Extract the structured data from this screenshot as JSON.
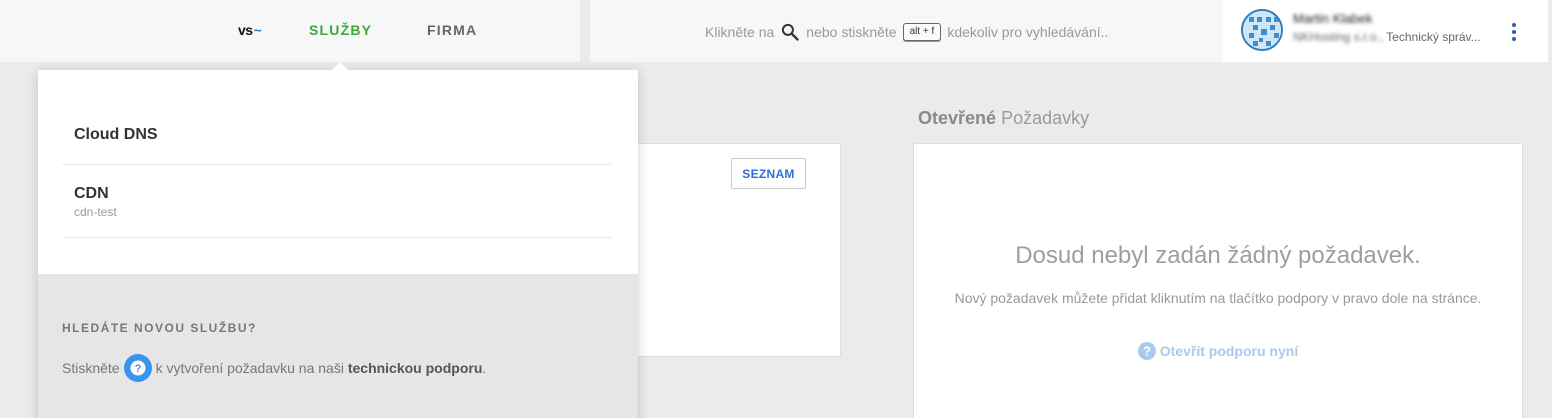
{
  "header": {
    "logo": {
      "text": "vs",
      "accent": "~"
    },
    "tabs": [
      {
        "label": "SLUŽBY",
        "active": true
      },
      {
        "label": "FIRMA",
        "active": false
      }
    ],
    "search": {
      "prefix": "Klikněte na",
      "middle": "nebo stiskněte",
      "shortcut": "alt + f",
      "suffix": "kdekoliv pro vyhledávání.."
    },
    "user": {
      "name": "Martin Klabek",
      "company": "NKHosting s.r.o.,",
      "role": "Technický správ..."
    }
  },
  "dropdown": {
    "items": [
      {
        "title": "Cloud DNS",
        "subtitle": ""
      },
      {
        "title": "CDN",
        "subtitle": "cdn-test"
      }
    ],
    "footer": {
      "heading": "HLEDÁTE NOVOU SLUŽBU?",
      "text_before": "Stiskněte",
      "text_middle": "k vytvoření požadavku na naši",
      "text_bold": "technickou podporu",
      "text_after": "."
    }
  },
  "services_card": {
    "button_label": "SEZNAM"
  },
  "requests": {
    "title_bold": "Otevřené",
    "title_rest": "Požadavky",
    "empty_title": "Dosud nebyl zadán žádný požadavek.",
    "empty_subtitle": "Nový požadavek můžete přidat kliknutím na tlačítko podpory v pravo dole na stránce.",
    "open_support_label": "Otevřít podporu nyní"
  },
  "colors": {
    "accent_green": "#3ea73e",
    "accent_blue": "#2e6fd6",
    "help_blue": "#3a93ec"
  }
}
